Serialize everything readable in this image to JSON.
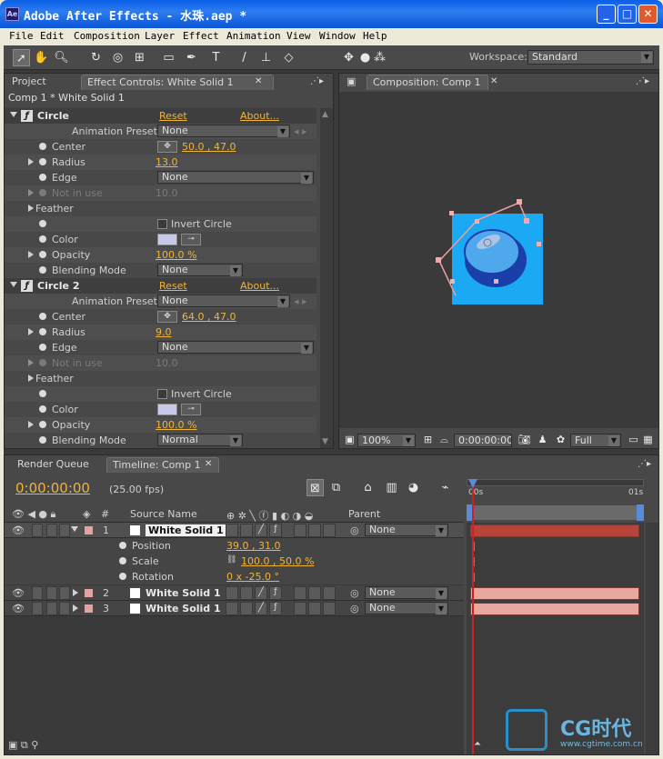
{
  "window": {
    "title": "Adobe After Effects - 水珠.aep *",
    "app_icon_text": "Ae"
  },
  "menu": [
    "File",
    "Edit",
    "Composition",
    "Layer",
    "Effect",
    "Animation",
    "View",
    "Window",
    "Help"
  ],
  "toolbar": {
    "workspace_label": "Workspace:",
    "workspace_value": "Standard"
  },
  "effect_panel": {
    "tabs": {
      "project": "Project",
      "effect_controls": "Effect Controls: White Solid 1"
    },
    "breadcrumb": "Comp 1 * White Solid 1",
    "effects": [
      {
        "name": "Circle",
        "reset": "Reset",
        "about": "About...",
        "presets_label": "Animation Presets:",
        "presets_value": "None",
        "center_label": "Center",
        "center_value": "50.0 , 47.0",
        "radius_label": "Radius",
        "radius_value": "13.0",
        "edge_label": "Edge",
        "edge_value": "None",
        "notinuse_label": "Not in use",
        "notinuse_value": "10.0",
        "feather_label": "Feather",
        "invert_label": "Invert Circle",
        "color_label": "Color",
        "opacity_label": "Opacity",
        "opacity_value": "100.0 %",
        "blend_label": "Blending Mode",
        "blend_value": "None"
      },
      {
        "name": "Circle 2",
        "reset": "Reset",
        "about": "About...",
        "presets_label": "Animation Presets:",
        "presets_value": "None",
        "center_label": "Center",
        "center_value": "64.0 , 47.0",
        "radius_label": "Radius",
        "radius_value": "9.0",
        "edge_label": "Edge",
        "edge_value": "None",
        "notinuse_label": "Not in use",
        "notinuse_value": "10.0",
        "feather_label": "Feather",
        "invert_label": "Invert Circle",
        "color_label": "Color",
        "opacity_label": "Opacity",
        "opacity_value": "100.0 %",
        "blend_label": "Blending Mode",
        "blend_value": "Normal"
      }
    ]
  },
  "comp_panel": {
    "tab": "Composition: Comp 1",
    "zoom": "100%",
    "timecode": "0:00:00:00",
    "resolution": "Full"
  },
  "timeline": {
    "tabs": {
      "render_queue": "Render Queue",
      "timeline": "Timeline: Comp 1"
    },
    "timecode": "0:00:00:00",
    "fps": "(25.00 fps)",
    "columns": {
      "num": "#",
      "source": "Source Name",
      "parent": "Parent"
    },
    "ruler": {
      "start": "00s",
      "end": "01s"
    },
    "layers": [
      {
        "num": "1",
        "name": "White Solid 1",
        "parent": "None"
      },
      {
        "num": "2",
        "name": "White Solid 1",
        "parent": "None"
      },
      {
        "num": "3",
        "name": "White Solid 1",
        "parent": "None"
      }
    ],
    "props": [
      {
        "label": "Position",
        "value": "39.0 , 31.0"
      },
      {
        "label": "Scale",
        "value": "100.0 , 50.0 %"
      },
      {
        "label": "Rotation",
        "value": "0 x -25.0 °"
      }
    ]
  },
  "watermark": {
    "brand": "CG时代",
    "url": "www.cgtime.com.cn"
  }
}
